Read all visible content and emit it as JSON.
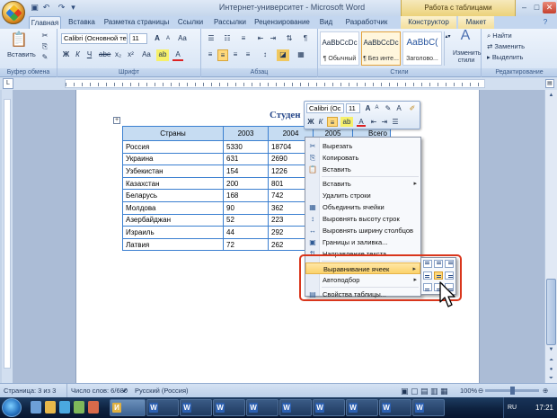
{
  "window": {
    "title": "Интернет-университет - Microsoft Word",
    "context_tab_group": "Работа с таблицами"
  },
  "tabs": [
    "Главная",
    "Вставка",
    "Разметка страницы",
    "Ссылки",
    "Рассылки",
    "Рецензирование",
    "Вид",
    "Разработчик",
    "Конструктор",
    "Макет"
  ],
  "active_tab": "Главная",
  "ribbon": {
    "clipboard": {
      "paste": "Вставить",
      "label": "Буфер обмена"
    },
    "font": {
      "name": "Calibri (Основной те",
      "size": "11",
      "label": "Шрифт",
      "bold": "Ж",
      "italic": "К",
      "underline": "Ч",
      "grow": "A",
      "shrink": "A",
      "clear": "Aa",
      "color_a": "A"
    },
    "paragraph": {
      "label": "Абзац",
      "pilcrow": "¶"
    },
    "styles": {
      "label": "Стили",
      "items": [
        {
          "preview": "AaBbCcDc",
          "name": "¶ Обычный"
        },
        {
          "preview": "AaBbCcDc",
          "name": "¶ Без инте..."
        },
        {
          "preview": "AaBbC(",
          "name": "Заголово..."
        }
      ],
      "change_styles": "Изменить стили"
    },
    "editing": {
      "find": "Найти",
      "replace": "Заменить",
      "select": "Выделить",
      "label": "Редактирование"
    }
  },
  "document": {
    "heading": "Студен",
    "table": {
      "headers": [
        "Страны",
        "2003",
        "2004",
        "2005",
        "Всего"
      ],
      "rows": [
        [
          "Россия",
          "5330",
          "18704",
          "",
          "7"
        ],
        [
          "Украина",
          "631",
          "2690",
          "",
          "1"
        ],
        [
          "Узбекистан",
          "154",
          "1226",
          "",
          ""
        ],
        [
          "Казахстан",
          "200",
          "801",
          "",
          ""
        ],
        [
          "Беларусь",
          "168",
          "742",
          "",
          ""
        ],
        [
          "Молдова",
          "90",
          "362",
          "",
          ""
        ],
        [
          "Азербайджан",
          "52",
          "223",
          "",
          ""
        ],
        [
          "Израиль",
          "44",
          "292",
          "",
          ""
        ],
        [
          "Латвия",
          "72",
          "262",
          "",
          ""
        ]
      ]
    }
  },
  "mini_toolbar": {
    "font": "Calibri (Oc",
    "size": "11",
    "bold": "Ж",
    "italic": "К",
    "color_a": "A"
  },
  "context_menu": {
    "items": [
      {
        "label": "Вырезать",
        "icon": "scissors-icon"
      },
      {
        "label": "Копировать",
        "icon": "copy-icon"
      },
      {
        "label": "Вставить",
        "icon": "paste-icon"
      },
      {
        "label": "Вставить",
        "icon": "",
        "submenu": true
      },
      {
        "label": "Удалить строки",
        "icon": ""
      },
      {
        "label": "Объединить ячейки",
        "icon": "merge-cells-icon"
      },
      {
        "label": "Выровнять высоту строк",
        "icon": "row-height-icon"
      },
      {
        "label": "Выровнять ширину столбцов",
        "icon": "column-width-icon"
      },
      {
        "label": "Границы и заливка...",
        "icon": "borders-icon"
      },
      {
        "label": "Направление текста...",
        "icon": "text-direction-icon"
      },
      {
        "label": "Выравнивание ячеек",
        "icon": "",
        "submenu": true,
        "highlighted": true
      },
      {
        "label": "Автоподбор",
        "icon": "",
        "submenu": true
      },
      {
        "label": "Свойства таблицы...",
        "icon": "table-properties-icon"
      }
    ]
  },
  "status_bar": {
    "page": "Страница: 3 из 3",
    "words": "Число слов: 6/680",
    "language": "Русский (Россия)",
    "zoom": "100%"
  },
  "taskbar": {
    "buttons": [
      "И",
      "W",
      "W",
      "W",
      "W",
      "W",
      "W",
      "W",
      "W",
      "W"
    ],
    "clock": "17:21",
    "lang": "RU"
  }
}
